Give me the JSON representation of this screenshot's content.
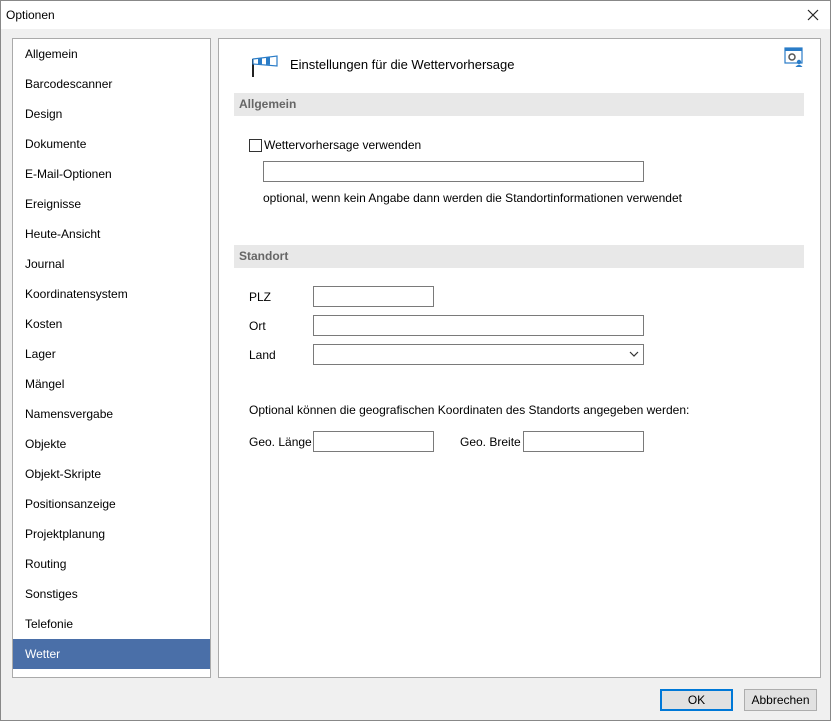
{
  "window": {
    "title": "Optionen"
  },
  "sidebar": {
    "items": [
      {
        "label": "Allgemein"
      },
      {
        "label": "Barcodescanner"
      },
      {
        "label": "Design"
      },
      {
        "label": "Dokumente"
      },
      {
        "label": "E-Mail-Optionen"
      },
      {
        "label": "Ereignisse"
      },
      {
        "label": "Heute-Ansicht"
      },
      {
        "label": "Journal"
      },
      {
        "label": "Koordinatensystem"
      },
      {
        "label": "Kosten"
      },
      {
        "label": "Lager"
      },
      {
        "label": "Mängel"
      },
      {
        "label": "Namensvergabe"
      },
      {
        "label": "Objekte"
      },
      {
        "label": "Objekt-Skripte"
      },
      {
        "label": "Positionsanzeige"
      },
      {
        "label": "Projektplanung"
      },
      {
        "label": "Routing"
      },
      {
        "label": "Sonstiges"
      },
      {
        "label": "Telefonie"
      },
      {
        "label": "Wetter"
      }
    ],
    "selected": "Wetter",
    "selected_color": "#4a6fa8"
  },
  "header": {
    "title": "Einstellungen für die Wettervorhersage",
    "icon": "windsock-icon",
    "corner_icon": "settings-user-icon"
  },
  "general": {
    "section_title": "Allgemein",
    "checkbox_label": "Wettervorhersage verwenden",
    "checkbox_checked": false,
    "api_value": "",
    "hint": "optional, wenn kein Angabe dann werden die Standortinformationen verwendet"
  },
  "location": {
    "section_title": "Standort",
    "plz_label": "PLZ",
    "plz_value": "",
    "ort_label": "Ort",
    "ort_value": "",
    "land_label": "Land",
    "land_value": "",
    "coords_hint": "Optional können die geografischen Koordinaten des Standorts angegeben werden:",
    "lon_label": "Geo. Länge",
    "lon_value": "",
    "lat_label": "Geo. Breite",
    "lat_value": ""
  },
  "footer": {
    "ok_label": "OK",
    "cancel_label": "Abbrechen"
  }
}
